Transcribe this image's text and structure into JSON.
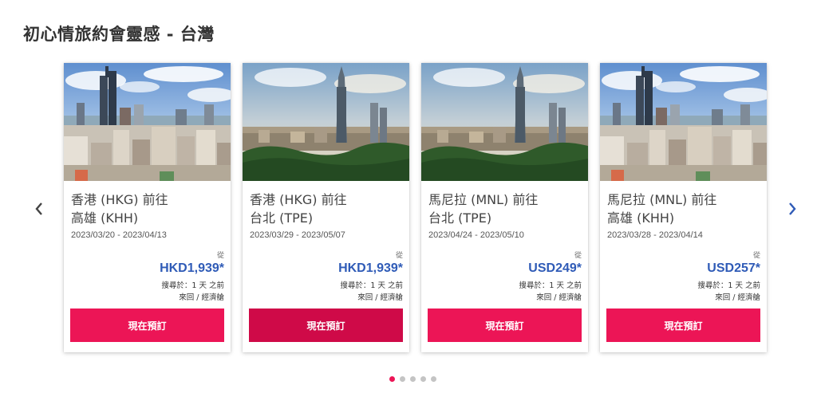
{
  "section": {
    "title": "初心情旅約會靈感 - 台灣"
  },
  "nav": {
    "prev_icon": "chevron-left-icon",
    "next_icon": "chevron-right-icon",
    "color": "#2f5bb7"
  },
  "cards": [
    {
      "image": "kaohsiung-skyline",
      "route_line1": "香港 (HKG) 前往",
      "route_line2": "高雄 (KHH)",
      "dates": "2023/03/20 - 2023/04/13",
      "from_label": "從",
      "price": "HKD1,939*",
      "search_time": "搜尋於：1 天 之前",
      "trip_type": "來回 / 經濟艙",
      "button": "現在預訂"
    },
    {
      "image": "taipei-101-skyline",
      "route_line1": "香港 (HKG) 前往",
      "route_line2": "台北 (TPE)",
      "dates": "2023/03/29 - 2023/05/07",
      "from_label": "從",
      "price": "HKD1,939*",
      "search_time": "搜尋於：1 天 之前",
      "trip_type": "來回 / 經濟艙",
      "button": "現在預訂"
    },
    {
      "image": "taipei-101-skyline",
      "route_line1": "馬尼拉 (MNL) 前往",
      "route_line2": "台北 (TPE)",
      "dates": "2023/04/24 - 2023/05/10",
      "from_label": "從",
      "price": "USD249*",
      "search_time": "搜尋於：1 天 之前",
      "trip_type": "來回 / 經濟艙",
      "button": "現在預訂"
    },
    {
      "image": "kaohsiung-skyline",
      "route_line1": "馬尼拉 (MNL) 前往",
      "route_line2": "高雄 (KHH)",
      "dates": "2023/03/28 - 2023/04/14",
      "from_label": "從",
      "price": "USD257*",
      "search_time": "搜尋於：1 天 之前",
      "trip_type": "來回 / 經濟艙",
      "button": "現在預訂"
    }
  ],
  "pagination": {
    "total": 5,
    "active_index": 0
  },
  "colors": {
    "accent": "#ec1556",
    "accent_active": "#cf0a48",
    "price": "#2f5bb7"
  }
}
